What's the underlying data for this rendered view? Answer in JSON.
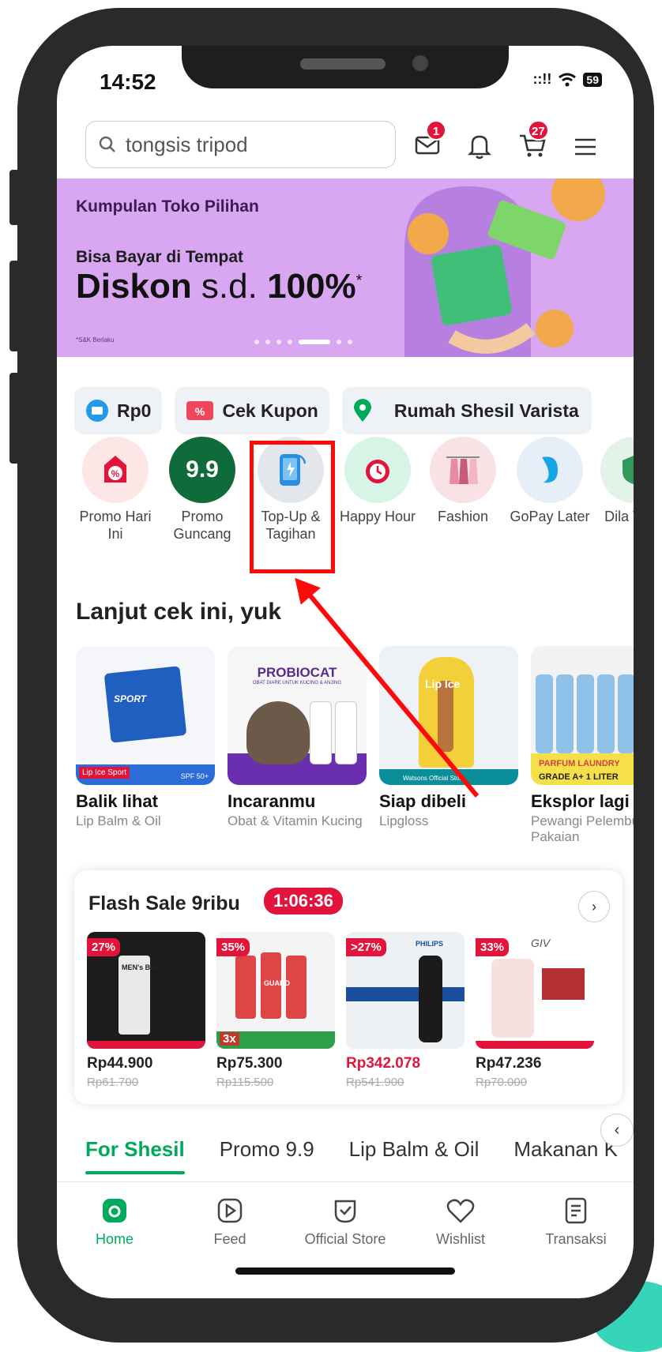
{
  "status_bar": {
    "time": "14:52",
    "signal": "::!!",
    "battery": "59"
  },
  "header": {
    "search_value": "tongsis tripod",
    "mail_badge": "1",
    "cart_badge": "27"
  },
  "banner": {
    "kicker": "Kumpulan Toko Pilihan",
    "subtitle": "Bisa Bayar di Tempat",
    "headline_bold": "Diskon",
    "headline_rest": " s.d. ",
    "headline_pct": "100%",
    "asterisk": "*",
    "terms": "*S&K Berlaku",
    "color": "#d9a6f2"
  },
  "quick_pills": [
    {
      "label": "Rp0",
      "icon": "wallet-icon"
    },
    {
      "label": "Cek Kupon",
      "icon": "coupon-icon"
    },
    {
      "label": "Rumah Shesil Varista",
      "icon": "location-pin-icon"
    }
  ],
  "categories": [
    {
      "label": "Promo Hari Ini",
      "icon": "promo-tag-icon"
    },
    {
      "label": "Promo Guncang",
      "icon": "9-9-icon",
      "icon_text": "9.9"
    },
    {
      "label": "Top-Up & Tagihan",
      "icon": "phone-topup-icon"
    },
    {
      "label": "Happy Hour",
      "icon": "alarm-clock-icon"
    },
    {
      "label": "Fashion",
      "icon": "clothes-rack-icon"
    },
    {
      "label": "GoPay Later",
      "icon": "gopay-later-icon"
    },
    {
      "label": "Dila Toko",
      "icon": "shield-store-icon"
    }
  ],
  "section_title": "Lanjut cek ini, yuk",
  "recent_cards": [
    {
      "title": "Balik lihat",
      "subtitle": "Lip Balm & Oil",
      "img_text": "Lip Ice Sport",
      "img_text2": "SPF 50+"
    },
    {
      "title": "Incaranmu",
      "subtitle": "Obat & Vitamin Kucing",
      "img_text": "PROBIOCAT",
      "img_text2": "OBAT DIARE UNTUK KUCING & ANJING"
    },
    {
      "title": "Siap dibeli",
      "subtitle": "Lipgloss",
      "img_text": "Lip Ice",
      "img_text2": "Watsons Official Store"
    },
    {
      "title": "Eksplor lagi",
      "subtitle": "Pewangi Pelembut Pakaian",
      "img_text": "PARFUM LAUNDRY",
      "img_text2": "GRADE A+ 1 LITER"
    }
  ],
  "flash_sale": {
    "title": "Flash Sale 9ribu",
    "timer": "1:06:36",
    "products": [
      {
        "discount": "27%",
        "price": "Rp44.900",
        "old_price": "Rp61.700",
        "red": false,
        "brand": "MEN's Biore"
      },
      {
        "discount": "35%",
        "price": "Rp75.300",
        "old_price": "Rp115.500",
        "red": false,
        "brand": "GUARD",
        "multi": "3x"
      },
      {
        "discount": ">27%",
        "price": "Rp342.078",
        "old_price": "Rp541.900",
        "red": true,
        "brand": "PHILIPS"
      },
      {
        "discount": "33%",
        "price": "Rp47.236",
        "old_price": "Rp70.000",
        "red": false,
        "brand": "GIV"
      }
    ]
  },
  "tabs": [
    {
      "label": "For Shesil",
      "active": true
    },
    {
      "label": "Promo 9.9",
      "active": false
    },
    {
      "label": "Lip Balm & Oil",
      "active": false
    },
    {
      "label": "Makanan K",
      "active": false
    }
  ],
  "bottom_nav": [
    {
      "label": "Home",
      "icon": "home-icon",
      "active": true
    },
    {
      "label": "Feed",
      "icon": "play-icon",
      "active": false
    },
    {
      "label": "Official Store",
      "icon": "official-store-icon",
      "active": false
    },
    {
      "label": "Wishlist",
      "icon": "heart-icon",
      "active": false
    },
    {
      "label": "Transaksi",
      "icon": "receipt-icon",
      "active": false
    }
  ],
  "colors": {
    "accent": "#00aa5b",
    "badge": "#e2143b",
    "annotation": "#ff0a0a"
  }
}
